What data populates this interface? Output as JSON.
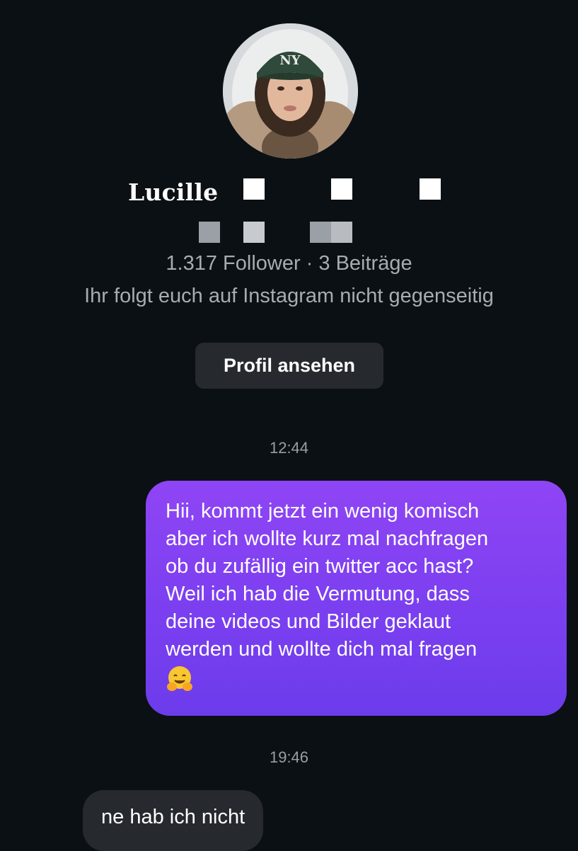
{
  "profile": {
    "name": "Lucille",
    "stats": "1.317 Follower · 3 Beiträge",
    "mutual_note": "Ihr folgt euch auf Instagram nicht gegenseitig",
    "view_profile_label": "Profil ansehen",
    "avatar_alt": "profile photo",
    "cap_text": "NY"
  },
  "messages": [
    {
      "time": "12:44",
      "direction": "outgoing",
      "lines": [
        "Hii, kommt jetzt ein wenig komisch",
        "aber ich wollte kurz mal nachfragen",
        "ob du zufällig ein twitter acc hast?",
        "Weil ich hab die Vermutung, dass",
        "deine videos und Bilder geklaut",
        "werden und wollte dich mal fragen"
      ],
      "emoji": "hugging-face"
    },
    {
      "time": "19:46",
      "direction": "incoming",
      "text": "ne hab ich nicht"
    }
  ],
  "colors": {
    "background": "#0b1014",
    "outgoing_bubble": "#7b3ff0",
    "incoming_bubble": "#262a2f",
    "secondary_text": "#a8acb0"
  }
}
